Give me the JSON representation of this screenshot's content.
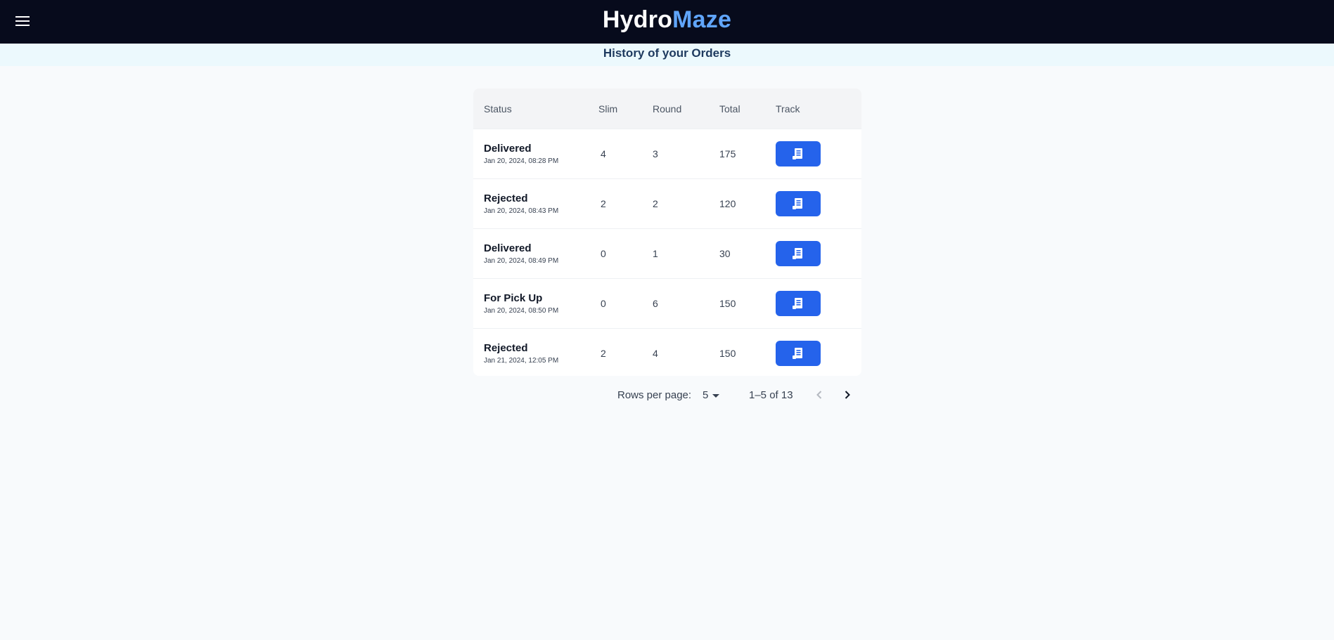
{
  "header": {
    "brand_part1": "Hydro",
    "brand_part2": "Maze",
    "menu_icon": "hamburger-menu-icon",
    "colors": {
      "background": "#070b1c",
      "brand_accent": "#60a5fa"
    }
  },
  "page": {
    "title": "History of your Orders"
  },
  "table": {
    "columns": [
      "Status",
      "Slim",
      "Round",
      "Total",
      "Track"
    ],
    "track_icon": "receipt-icon",
    "rows": [
      {
        "status": "Delivered",
        "date": "Jan 20, 2024, 08:28 PM",
        "slim": "4",
        "round": "3",
        "total": "175"
      },
      {
        "status": "Rejected",
        "date": "Jan 20, 2024, 08:43 PM",
        "slim": "2",
        "round": "2",
        "total": "120"
      },
      {
        "status": "Delivered",
        "date": "Jan 20, 2024, 08:49 PM",
        "slim": "0",
        "round": "1",
        "total": "30"
      },
      {
        "status": "For Pick Up",
        "date": "Jan 20, 2024, 08:50 PM",
        "slim": "0",
        "round": "6",
        "total": "150"
      },
      {
        "status": "Rejected",
        "date": "Jan 21, 2024, 12:05 PM",
        "slim": "2",
        "round": "4",
        "total": "150"
      }
    ],
    "accent_color": "#2563eb"
  },
  "pagination": {
    "rows_per_page_label": "Rows per page:",
    "rows_per_page_value": "5",
    "range_text": "1–5 of 13",
    "prev_icon": "chevron-left-icon",
    "next_icon": "chevron-right-icon"
  }
}
